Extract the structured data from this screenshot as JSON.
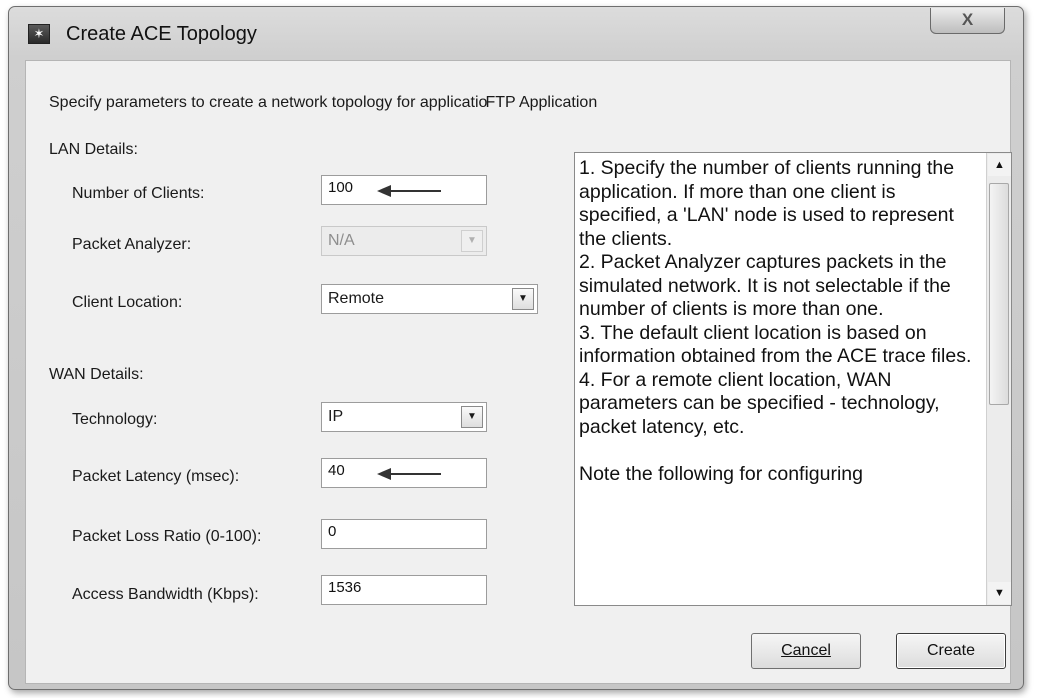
{
  "window": {
    "title": "Create ACE Topology",
    "close_glyph": "X",
    "icon": "ace-app-icon",
    "icon_glyph": "✶"
  },
  "intro_prefix": "Specify parameters to create a network topology for applicatio",
  "application_name": "FTP Application",
  "lan": {
    "heading": "LAN Details:",
    "clients_label": "Number of Clients:",
    "clients_value": "100",
    "analyzer_label": "Packet Analyzer:",
    "analyzer_value": "N/A",
    "location_label": "Client Location:",
    "location_value": "Remote"
  },
  "wan": {
    "heading": "WAN Details:",
    "technology_label": "Technology:",
    "technology_value": "IP",
    "latency_label": "Packet Latency (msec):",
    "latency_value": "40",
    "loss_label": "Packet Loss Ratio (0-100):",
    "loss_value": "0",
    "bandwidth_label": "Access Bandwidth (Kbps):",
    "bandwidth_value": "1536"
  },
  "info_text": [
    "1. Specify the number of clients running the application. If more than one client is specified, a 'LAN' node is used to represent the clients.",
    "2. Packet Analyzer captures packets in the simulated network. It is not selectable if the number of clients is more than one.",
    "3. The default client location is based on information obtained from the ACE trace files.",
    "4. For a remote client location, WAN parameters can be specified - technology, packet latency, etc.",
    "",
    "Note the following for configuring"
  ],
  "buttons": {
    "cancel": "Cancel",
    "create": "Create"
  },
  "icons": {
    "dropdown": "chevron-down-icon",
    "scroll_up": "scroll-up-icon",
    "scroll_down": "scroll-down-icon",
    "annotation_arrow": "left-arrow-icon"
  },
  "colors": {
    "dialog_bg": "#f0f0f0",
    "titlebar": "#d2d2d2",
    "text": "#1a1a1a",
    "disabled_text": "#8e8e8e"
  }
}
